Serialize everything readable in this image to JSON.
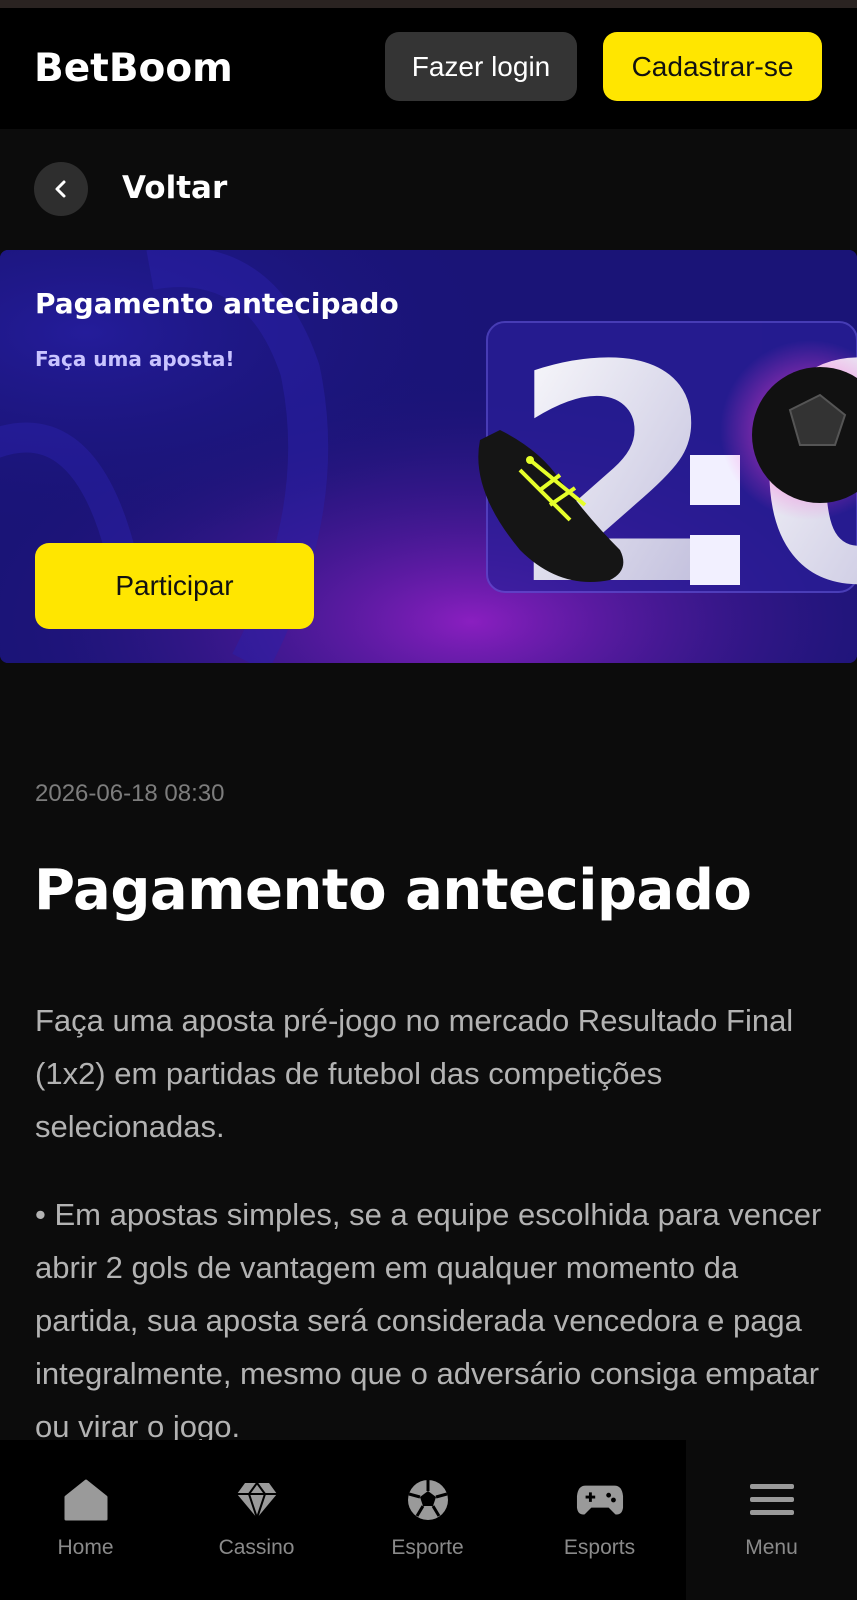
{
  "header": {
    "logo": "BetBoom",
    "login_label": "Fazer login",
    "register_label": "Cadastrar-se"
  },
  "back": {
    "label": "Voltar",
    "icon": "chevron-left-icon"
  },
  "banner": {
    "title": "Pagamento antecipado",
    "subtitle": "Faça uma aposta!",
    "cta_label": "Participar",
    "score_art": "2:0"
  },
  "article": {
    "date": "2026-06-18 08:30",
    "title": "Pagamento antecipado",
    "paragraphs": [
      "Faça uma aposta pré-jogo no mercado Resultado Final (1x2) em partidas de futebol das competições selecionadas.",
      "• Em apostas simples, se a equipe escolhida para vencer abrir 2 gols de vantagem em qualquer momento da partida, sua aposta será considerada vencedora e paga integralmente, mesmo que o adversário consiga empatar ou virar o jogo."
    ]
  },
  "bottom_nav": [
    {
      "label": "Home",
      "icon": "home-icon"
    },
    {
      "label": "Cassino",
      "icon": "diamond-icon"
    },
    {
      "label": "Esporte",
      "icon": "soccer-ball-icon"
    },
    {
      "label": "Esports",
      "icon": "gamepad-icon"
    },
    {
      "label": "Menu",
      "icon": "menu-icon"
    }
  ],
  "colors": {
    "accent_yellow": "#ffe600",
    "background": "#0c0c0c",
    "header": "#000000",
    "banner_blue": "#1a1477",
    "banner_purple": "#6a1aa8"
  }
}
